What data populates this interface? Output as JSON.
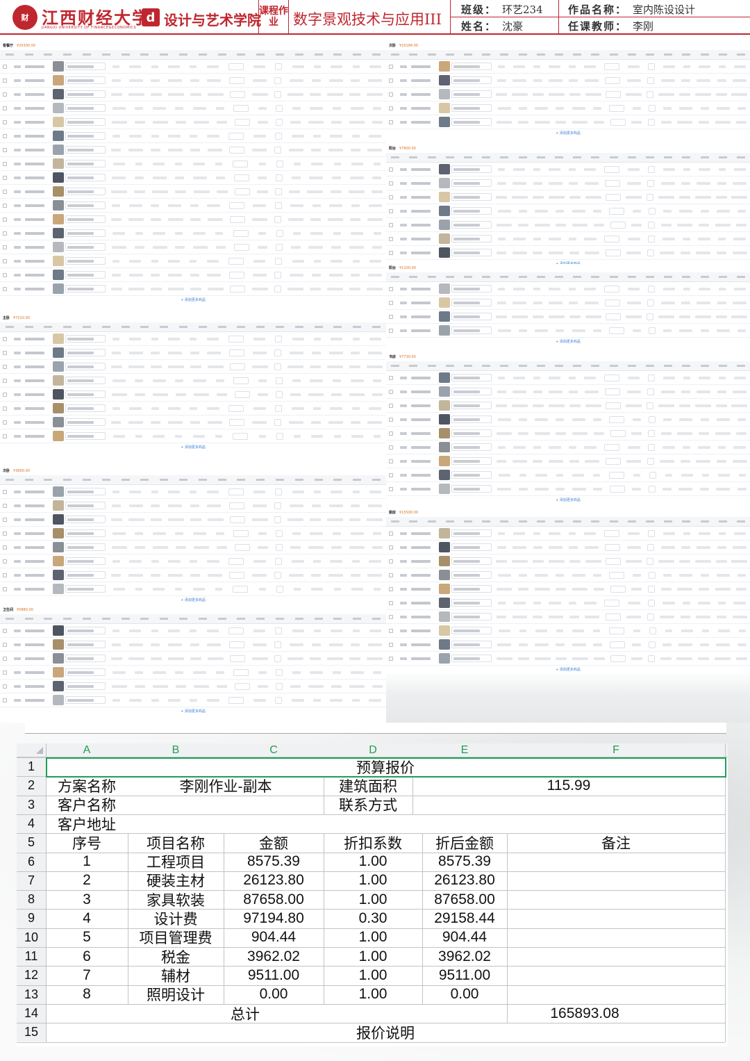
{
  "header": {
    "university": "江西财经大学",
    "university_en": "JIANGXI UNIVERSITY OF FINANCE&ECONOMICS",
    "seal_text": "江西财经大学",
    "college": "设计与艺术学院",
    "course_type": "课程作业",
    "course_name": "数字景观技术与应用III",
    "class_label": "班级：",
    "class_value": "环艺234",
    "name_label": "姓名：",
    "name_value": "沈豪",
    "work_label": "作品名称：",
    "work_value": "室内陈设设计",
    "teacher_label": "任课教师：",
    "teacher_value": "李刚"
  },
  "add_link": "+ 添加更多商品",
  "tables": [
    {
      "room": "客餐厅",
      "amount": "¥20300.00",
      "rows": 17
    },
    {
      "room": "次卧",
      "amount": "¥10184.00",
      "rows": 5
    },
    {
      "room": "阳台",
      "amount": "¥7900.00",
      "rows": 7
    },
    {
      "room": "阳台",
      "amount": "¥1100.00",
      "rows": 4
    },
    {
      "room": "主卧",
      "amount": "¥7210.00",
      "rows": 8
    },
    {
      "room": "书房",
      "amount": "¥7730.00",
      "rows": 9
    },
    {
      "room": "次卧",
      "amount": "¥3600.00",
      "rows": 8
    },
    {
      "room": "厨房",
      "amount": "¥15500.00",
      "rows": 10
    },
    {
      "room": "卫生间",
      "amount": "¥5880.00",
      "rows": 6
    }
  ],
  "sheet": {
    "columns": [
      "A",
      "B",
      "C",
      "D",
      "E",
      "F"
    ],
    "row_numbers": [
      "1",
      "2",
      "3",
      "4",
      "5",
      "6",
      "7",
      "8",
      "9",
      "10",
      "11",
      "12",
      "13",
      "14",
      "15"
    ],
    "title": "预算报价",
    "scheme_label": "方案名称",
    "scheme_value": "李刚作业-副本",
    "area_label": "建筑面积",
    "area_value": "115.99",
    "client_label": "客户名称",
    "contact_label": "联系方式",
    "address_label": "客户地址",
    "col_headers": [
      "序号",
      "项目名称",
      "金额",
      "折扣系数",
      "折后金额",
      "备注"
    ],
    "items": [
      {
        "no": "1",
        "name": "工程项目",
        "amount": "8575.39",
        "discount": "1.00",
        "final": "8575.39"
      },
      {
        "no": "2",
        "name": "硬装主材",
        "amount": "26123.80",
        "discount": "1.00",
        "final": "26123.80"
      },
      {
        "no": "3",
        "name": "家具软装",
        "amount": "87658.00",
        "discount": "1.00",
        "final": "87658.00"
      },
      {
        "no": "4",
        "name": "设计费",
        "amount": "97194.80",
        "discount": "0.30",
        "final": "29158.44"
      },
      {
        "no": "5",
        "name": "项目管理费",
        "amount": "904.44",
        "discount": "1.00",
        "final": "904.44"
      },
      {
        "no": "6",
        "name": "税金",
        "amount": "3962.02",
        "discount": "1.00",
        "final": "3962.02"
      },
      {
        "no": "7",
        "name": "辅材",
        "amount": "9511.00",
        "discount": "1.00",
        "final": "9511.00"
      },
      {
        "no": "8",
        "name": "照明设计",
        "amount": "0.00",
        "discount": "1.00",
        "final": "0.00"
      }
    ],
    "total_label": "总计",
    "total_value": "165893.08",
    "note_label": "报价说明"
  }
}
